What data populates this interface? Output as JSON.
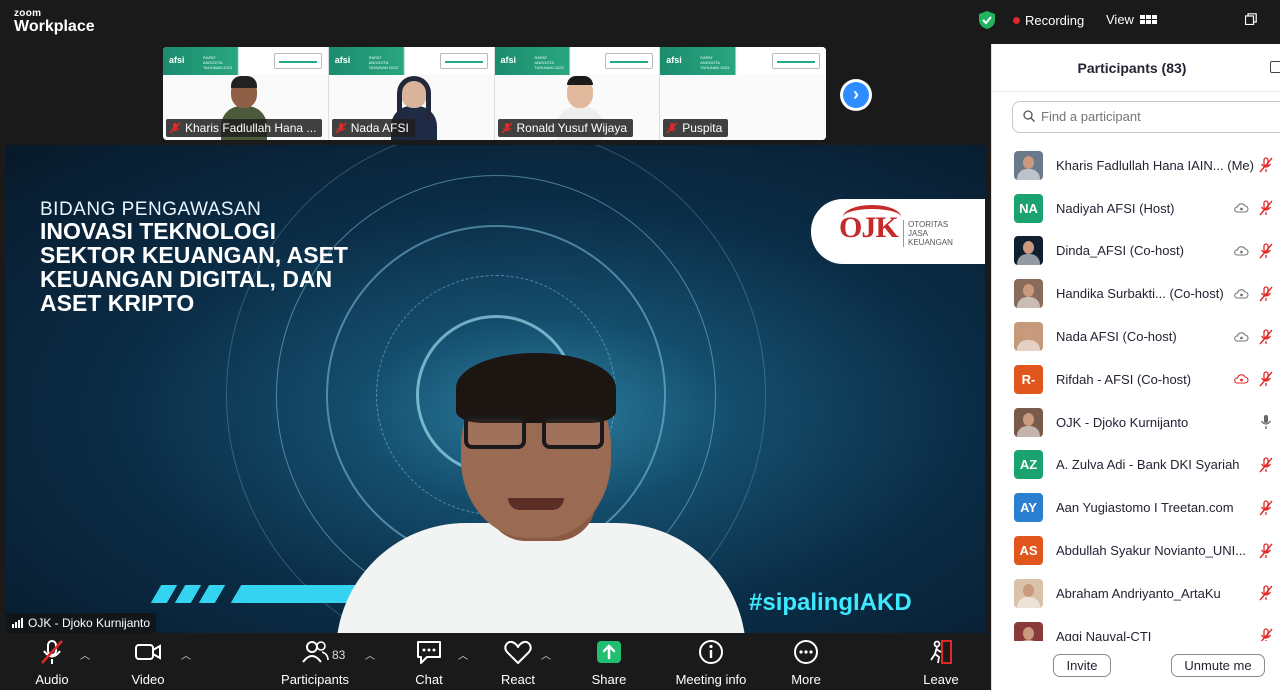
{
  "app": {
    "brand_top": "zoom",
    "brand_main": "Workplace"
  },
  "topbar": {
    "recording_label": "Recording",
    "view_label": "View"
  },
  "thumbnails": [
    {
      "name": "Kharis Fadlullah Hana ...",
      "muted": true
    },
    {
      "name": "Nada AFSI",
      "muted": true
    },
    {
      "name": "Ronald Yusuf Wijaya",
      "muted": true
    },
    {
      "name": "Puspita",
      "muted": true
    }
  ],
  "thumb_banner": {
    "logo": "afsi",
    "subtitle": "RAPAT ANGGOTA TAHUNAN 2023"
  },
  "main_video": {
    "speaker_name": "OJK - Djoko Kurnijanto",
    "slide_subtitle": "BIDANG PENGAWASAN",
    "slide_title": "INOVASI TEKNOLOGI SEKTOR KEUANGAN, ASET KEUANGAN DIGITAL, DAN ASET KRIPTO",
    "ojk_mark": "OJK",
    "ojk_text": [
      "OTORITAS",
      "JASA",
      "KEUANGAN"
    ],
    "hashtag": "#sipalingIAKD"
  },
  "toolbar": {
    "audio": "Audio",
    "video": "Video",
    "participants": "Participants",
    "participants_count": "83",
    "chat": "Chat",
    "react": "React",
    "share": "Share",
    "meeting_info": "Meeting info",
    "more": "More",
    "leave": "Leave"
  },
  "panel": {
    "title": "Participants (83)",
    "search_placeholder": "Find a participant",
    "participants": [
      {
        "name": "Kharis Fadlullah Hana IAIN...",
        "role": "(Me)",
        "avatar": "photo",
        "color": "#6b7a8a",
        "cloud": false,
        "mic": "muted"
      },
      {
        "name": "Nadiyah AFSI",
        "role": "(Host)",
        "avatar": "NA",
        "color": "#1aa36f",
        "cloud": true,
        "mic": "muted"
      },
      {
        "name": "Dinda_AFSI",
        "role": "(Co-host)",
        "avatar": "photo",
        "color": "#102030",
        "cloud": true,
        "mic": "muted"
      },
      {
        "name": "Handika Surbakti...",
        "role": "(Co-host)",
        "avatar": "photo",
        "color": "#8a6a5a",
        "cloud": true,
        "mic": "muted"
      },
      {
        "name": "Nada AFSI",
        "role": "(Co-host)",
        "avatar": "photo",
        "color": "#c59a7a",
        "cloud": true,
        "mic": "muted"
      },
      {
        "name": "Rifdah - AFSI",
        "role": "(Co-host)",
        "avatar": "R-",
        "color": "#e0561d",
        "cloud": "red",
        "mic": "muted"
      },
      {
        "name": "OJK - Djoko Kurnijanto",
        "role": "",
        "avatar": "photo",
        "color": "#7a5a4a",
        "cloud": false,
        "mic": "on"
      },
      {
        "name": "A. Zulva Adi - Bank DKI Syariah",
        "role": "",
        "avatar": "AZ",
        "color": "#1aa36f",
        "cloud": false,
        "mic": "muted"
      },
      {
        "name": "Aan Yugiastomo I Treetan.com",
        "role": "",
        "avatar": "AY",
        "color": "#2b7fd1",
        "cloud": false,
        "mic": "muted"
      },
      {
        "name": "Abdullah Syakur Novianto_UNI...",
        "role": "",
        "avatar": "AS",
        "color": "#e0561d",
        "cloud": false,
        "mic": "muted"
      },
      {
        "name": "Abraham Andriyanto_ArtaKu",
        "role": "",
        "avatar": "photo",
        "color": "#d9c2a8",
        "cloud": false,
        "mic": "muted"
      },
      {
        "name": "Aggi Nauval-CTI",
        "role": "",
        "avatar": "photo",
        "color": "#8a3a3a",
        "cloud": false,
        "mic": "muted"
      }
    ],
    "invite_label": "Invite",
    "unmute_label": "Unmute me"
  },
  "colors": {
    "accent": "#2d8cff",
    "muted_red": "#e02828",
    "share_green": "#1fbf6f"
  }
}
